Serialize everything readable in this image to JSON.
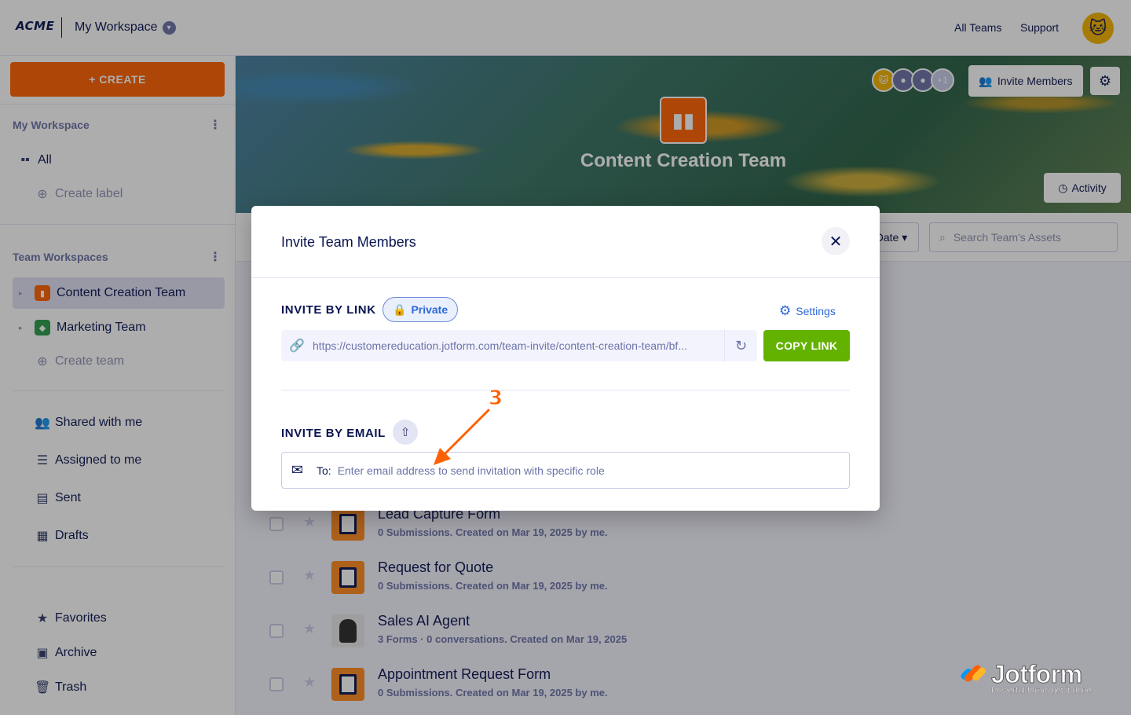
{
  "topbar": {
    "logo": "ACME",
    "workspace_title": "My Workspace",
    "links": [
      "All Teams",
      "Support"
    ]
  },
  "sidebar": {
    "create_label": "+ CREATE",
    "my_workspace_heading": "My Workspace",
    "all_label": "All",
    "create_label_link": "Create label",
    "team_workspaces_heading": "Team Workspaces",
    "teams": [
      {
        "label": "Content Creation Team",
        "color": "#ff6100"
      },
      {
        "label": "Marketing Team",
        "color": "#2d9b4c"
      }
    ],
    "create_team": "Create team",
    "nav": [
      {
        "label": "Shared with me",
        "icon": "shared-icon"
      },
      {
        "label": "Assigned to me",
        "icon": "list-icon"
      },
      {
        "label": "Sent",
        "icon": "sent-icon"
      },
      {
        "label": "Drafts",
        "icon": "drafts-icon"
      }
    ],
    "bottom": [
      {
        "label": "Favorites",
        "icon": "star-icon"
      },
      {
        "label": "Archive",
        "icon": "archive-icon"
      },
      {
        "label": "Trash",
        "icon": "trash-icon"
      }
    ]
  },
  "banner": {
    "team_name": "Content Creation Team",
    "avatar_more": "+1",
    "invite_label": "Invite Members",
    "activity_label": "Activity"
  },
  "toolbar": {
    "sort_label": "Date",
    "search_placeholder": "Search Team's Assets"
  },
  "assets": [
    {
      "name": "Lead Capture Form",
      "meta": "0 Submissions. Created on Mar 19, 2025 by me.",
      "kind": "form"
    },
    {
      "name": "Request for Quote",
      "meta": "0 Submissions. Created on Mar 19, 2025 by me.",
      "kind": "form"
    },
    {
      "name": "Sales AI Agent",
      "meta": "3 Forms · 0 conversations. Created on Mar 19, 2025",
      "kind": "agent"
    },
    {
      "name": "Appointment Request Form",
      "meta": "0 Submissions. Created on Mar 19, 2025 by me.",
      "kind": "form"
    }
  ],
  "modal": {
    "title": "Invite Team Members",
    "invite_by_link": "INVITE BY LINK",
    "private_label": "Private",
    "settings_label": "Settings",
    "invite_link": "https://customereducation.jotform.com/team-invite/content-creation-team/bf...",
    "copy_link_label": "COPY LINK",
    "invite_by_email": "INVITE BY EMAIL",
    "to_label": "To:",
    "email_placeholder": "Enter email address to send invitation with specific role"
  },
  "annotation": {
    "step": "3"
  },
  "watermark": {
    "brand": "Jotform",
    "tagline": "Powerful forms get it done"
  },
  "colors": {
    "accent": "#ff6100",
    "copy_button": "#64b200",
    "link_blue": "#2e69d8",
    "navy": "#0a1551"
  }
}
